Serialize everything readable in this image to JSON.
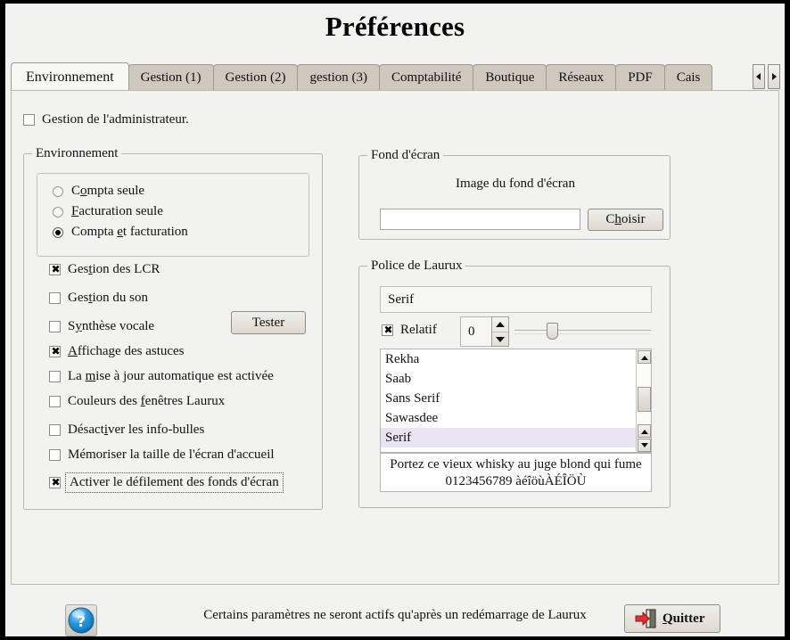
{
  "window": {
    "title": "Préférences"
  },
  "tabs": [
    {
      "label": "Environnement",
      "active": true
    },
    {
      "label": "Gestion (1)",
      "active": false
    },
    {
      "label": "Gestion (2)",
      "active": false
    },
    {
      "label": "gestion (3)",
      "active": false
    },
    {
      "label": "Comptabilité",
      "active": false
    },
    {
      "label": "Boutique",
      "active": false
    },
    {
      "label": "Réseaux",
      "active": false
    },
    {
      "label": "PDF",
      "active": false
    },
    {
      "label": "Cais",
      "active": false
    }
  ],
  "tab_nav": {
    "prev_icon": "triangle-left-icon",
    "next_icon": "triangle-right-icon"
  },
  "admin_checkbox": {
    "label": "Gestion de l'administrateur.",
    "checked": false
  },
  "environnement_group": {
    "legend": "Environnement",
    "radios": [
      {
        "label": "Compta seule",
        "mnemonic": "o",
        "selected": false
      },
      {
        "label": "Facturation seule",
        "mnemonic": "F",
        "selected": false
      },
      {
        "label": "Compta et facturation",
        "mnemonic": "e",
        "selected": true
      }
    ],
    "checkboxes": [
      {
        "label": "Gestion des LCR",
        "mnemonic": "t",
        "checked": true,
        "focused": false
      },
      {
        "label": "Gestion du son",
        "mnemonic": "t",
        "checked": false,
        "focused": false
      },
      {
        "label": "Synthèse vocale",
        "mnemonic": "y",
        "checked": false,
        "focused": false
      },
      {
        "label": "Affichage des astuces",
        "mnemonic": "A",
        "checked": true,
        "focused": false
      },
      {
        "label": "La mise à jour automatique est activée",
        "mnemonic": "m",
        "checked": false,
        "focused": false
      },
      {
        "label": "Couleurs des fenêtres Laurux",
        "mnemonic": "f",
        "checked": false,
        "focused": false
      },
      {
        "label": "Désactiver les info-bulles",
        "mnemonic": "i",
        "checked": false,
        "focused": false
      },
      {
        "label": "Mémoriser la taille de l'écran d'accueil",
        "mnemonic": "",
        "checked": false,
        "focused": false
      },
      {
        "label": "Activer le défilement des fonds d'écran",
        "mnemonic": "",
        "checked": true,
        "focused": true
      }
    ],
    "test_button": "Tester"
  },
  "fond_ecran_group": {
    "legend": "Fond d'écran",
    "caption": "Image du fond d'écran",
    "path_value": "",
    "path_placeholder": "",
    "choose_button": "Choisir",
    "choose_mnemonic": "h"
  },
  "police_group": {
    "legend": "Police de Laurux",
    "selected_font": "Serif",
    "relatif": {
      "label": "Relatif",
      "checked": true,
      "value": "0",
      "slider_position_percent": 26
    },
    "font_list": [
      {
        "name": "Rekha",
        "selected": false
      },
      {
        "name": "Saab",
        "selected": false
      },
      {
        "name": "Sans Serif",
        "selected": false
      },
      {
        "name": "Sawasdee",
        "selected": false
      },
      {
        "name": "Serif",
        "selected": true
      }
    ],
    "preview_line1": "Portez ce vieux whisky au juge blond qui fume",
    "preview_line2": "0123456789 àéîöùÀÉÎÖÙ"
  },
  "footer": {
    "help_icon": "help-question-icon",
    "status_message": "Certains paramètres ne seront actifs qu'après un redémarrage de Laurux",
    "quit_label": "Quitter",
    "quit_mnemonic": "Q",
    "quit_icon": "exit-door-icon"
  },
  "colors": {
    "window_bg": "#f2f2f0",
    "tab_inactive": "#cfc8bd",
    "tab_active": "#f7f7f5",
    "selection": "#e8e4f2",
    "border": "#b4b4ad",
    "text": "#111111"
  }
}
